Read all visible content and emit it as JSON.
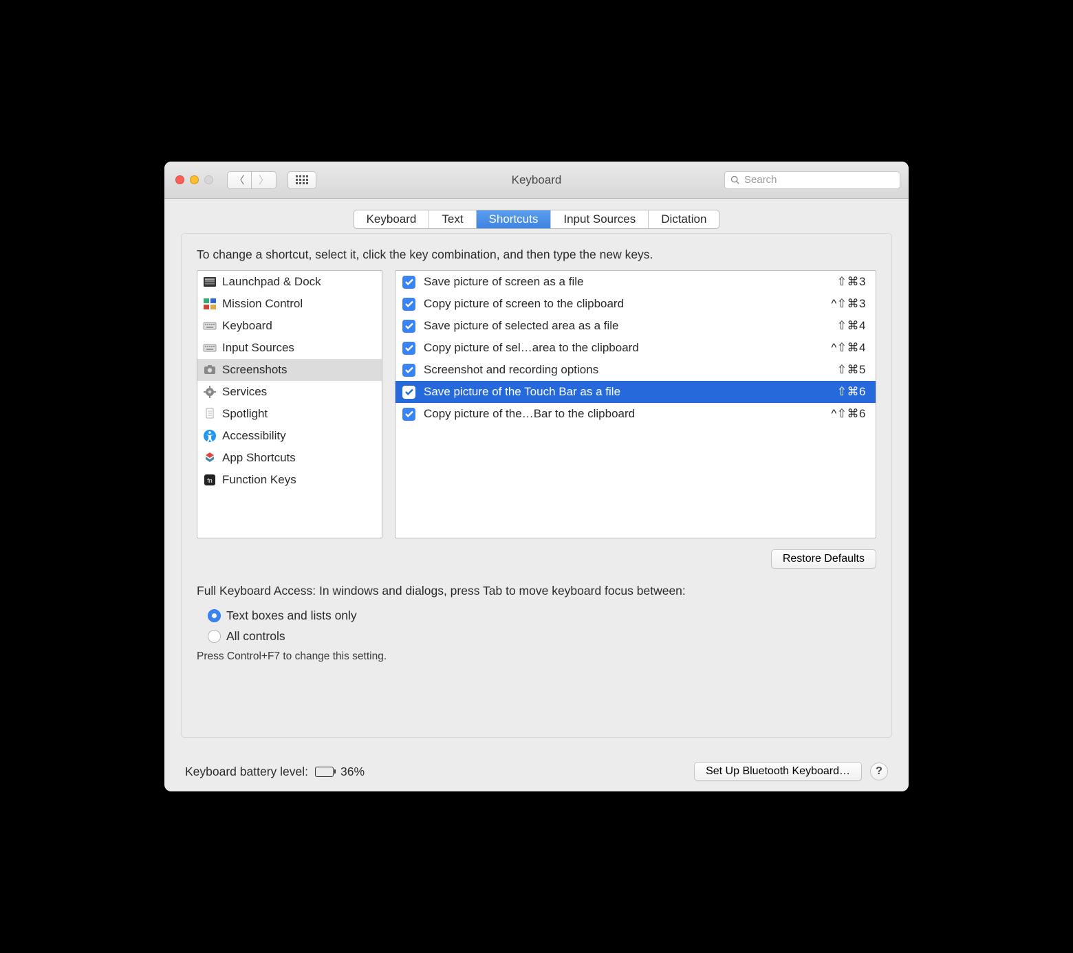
{
  "window": {
    "title": "Keyboard"
  },
  "toolbar": {
    "search_placeholder": "Search"
  },
  "tabs": [
    {
      "label": "Keyboard",
      "active": false
    },
    {
      "label": "Text",
      "active": false
    },
    {
      "label": "Shortcuts",
      "active": true
    },
    {
      "label": "Input Sources",
      "active": false
    },
    {
      "label": "Dictation",
      "active": false
    }
  ],
  "instruction": "To change a shortcut, select it, click the key combination, and then type the new keys.",
  "categories": [
    {
      "icon": "launchpad",
      "label": "Launchpad & Dock",
      "selected": false
    },
    {
      "icon": "mission",
      "label": "Mission Control",
      "selected": false
    },
    {
      "icon": "keyboard",
      "label": "Keyboard",
      "selected": false
    },
    {
      "icon": "keyboard",
      "label": "Input Sources",
      "selected": false
    },
    {
      "icon": "camera",
      "label": "Screenshots",
      "selected": true
    },
    {
      "icon": "gear",
      "label": "Services",
      "selected": false
    },
    {
      "icon": "spotlight",
      "label": "Spotlight",
      "selected": false
    },
    {
      "icon": "access",
      "label": "Accessibility",
      "selected": false
    },
    {
      "icon": "app",
      "label": "App Shortcuts",
      "selected": false
    },
    {
      "icon": "fn",
      "label": "Function Keys",
      "selected": false
    }
  ],
  "shortcuts": [
    {
      "enabled": true,
      "label": "Save picture of screen as a file",
      "keys": "⇧⌘3",
      "selected": false
    },
    {
      "enabled": true,
      "label": "Copy picture of screen to the clipboard",
      "keys": "^⇧⌘3",
      "selected": false
    },
    {
      "enabled": true,
      "label": "Save picture of selected area as a file",
      "keys": "⇧⌘4",
      "selected": false
    },
    {
      "enabled": true,
      "label": "Copy picture of sel…area to the clipboard",
      "keys": "^⇧⌘4",
      "selected": false
    },
    {
      "enabled": true,
      "label": "Screenshot and recording options",
      "keys": "⇧⌘5",
      "selected": false
    },
    {
      "enabled": true,
      "label": "Save picture of the Touch Bar as a file",
      "keys": "⇧⌘6",
      "selected": true
    },
    {
      "enabled": true,
      "label": "Copy picture of the…Bar to the clipboard",
      "keys": "^⇧⌘6",
      "selected": false
    }
  ],
  "restore_label": "Restore Defaults",
  "full_keyboard_access": {
    "text": "Full Keyboard Access: In windows and dialogs, press Tab to move keyboard focus between:",
    "options": [
      {
        "label": "Text boxes and lists only",
        "checked": true
      },
      {
        "label": "All controls",
        "checked": false
      }
    ],
    "note": "Press Control+F7 to change this setting."
  },
  "footer": {
    "battery_label": "Keyboard battery level:",
    "battery_percent": "36%",
    "battery_fill_pct": 36,
    "bluetooth_button": "Set Up Bluetooth Keyboard…",
    "help": "?"
  }
}
